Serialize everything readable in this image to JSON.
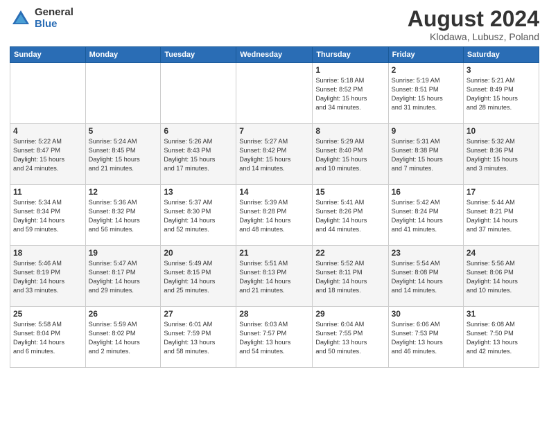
{
  "header": {
    "logo_general": "General",
    "logo_blue": "Blue",
    "title": "August 2024",
    "location": "Klodawa, Lubusz, Poland"
  },
  "weekdays": [
    "Sunday",
    "Monday",
    "Tuesday",
    "Wednesday",
    "Thursday",
    "Friday",
    "Saturday"
  ],
  "weeks": [
    [
      {
        "day": "",
        "info": ""
      },
      {
        "day": "",
        "info": ""
      },
      {
        "day": "",
        "info": ""
      },
      {
        "day": "",
        "info": ""
      },
      {
        "day": "1",
        "info": "Sunrise: 5:18 AM\nSunset: 8:52 PM\nDaylight: 15 hours\nand 34 minutes."
      },
      {
        "day": "2",
        "info": "Sunrise: 5:19 AM\nSunset: 8:51 PM\nDaylight: 15 hours\nand 31 minutes."
      },
      {
        "day": "3",
        "info": "Sunrise: 5:21 AM\nSunset: 8:49 PM\nDaylight: 15 hours\nand 28 minutes."
      }
    ],
    [
      {
        "day": "4",
        "info": "Sunrise: 5:22 AM\nSunset: 8:47 PM\nDaylight: 15 hours\nand 24 minutes."
      },
      {
        "day": "5",
        "info": "Sunrise: 5:24 AM\nSunset: 8:45 PM\nDaylight: 15 hours\nand 21 minutes."
      },
      {
        "day": "6",
        "info": "Sunrise: 5:26 AM\nSunset: 8:43 PM\nDaylight: 15 hours\nand 17 minutes."
      },
      {
        "day": "7",
        "info": "Sunrise: 5:27 AM\nSunset: 8:42 PM\nDaylight: 15 hours\nand 14 minutes."
      },
      {
        "day": "8",
        "info": "Sunrise: 5:29 AM\nSunset: 8:40 PM\nDaylight: 15 hours\nand 10 minutes."
      },
      {
        "day": "9",
        "info": "Sunrise: 5:31 AM\nSunset: 8:38 PM\nDaylight: 15 hours\nand 7 minutes."
      },
      {
        "day": "10",
        "info": "Sunrise: 5:32 AM\nSunset: 8:36 PM\nDaylight: 15 hours\nand 3 minutes."
      }
    ],
    [
      {
        "day": "11",
        "info": "Sunrise: 5:34 AM\nSunset: 8:34 PM\nDaylight: 14 hours\nand 59 minutes."
      },
      {
        "day": "12",
        "info": "Sunrise: 5:36 AM\nSunset: 8:32 PM\nDaylight: 14 hours\nand 56 minutes."
      },
      {
        "day": "13",
        "info": "Sunrise: 5:37 AM\nSunset: 8:30 PM\nDaylight: 14 hours\nand 52 minutes."
      },
      {
        "day": "14",
        "info": "Sunrise: 5:39 AM\nSunset: 8:28 PM\nDaylight: 14 hours\nand 48 minutes."
      },
      {
        "day": "15",
        "info": "Sunrise: 5:41 AM\nSunset: 8:26 PM\nDaylight: 14 hours\nand 44 minutes."
      },
      {
        "day": "16",
        "info": "Sunrise: 5:42 AM\nSunset: 8:24 PM\nDaylight: 14 hours\nand 41 minutes."
      },
      {
        "day": "17",
        "info": "Sunrise: 5:44 AM\nSunset: 8:21 PM\nDaylight: 14 hours\nand 37 minutes."
      }
    ],
    [
      {
        "day": "18",
        "info": "Sunrise: 5:46 AM\nSunset: 8:19 PM\nDaylight: 14 hours\nand 33 minutes."
      },
      {
        "day": "19",
        "info": "Sunrise: 5:47 AM\nSunset: 8:17 PM\nDaylight: 14 hours\nand 29 minutes."
      },
      {
        "day": "20",
        "info": "Sunrise: 5:49 AM\nSunset: 8:15 PM\nDaylight: 14 hours\nand 25 minutes."
      },
      {
        "day": "21",
        "info": "Sunrise: 5:51 AM\nSunset: 8:13 PM\nDaylight: 14 hours\nand 21 minutes."
      },
      {
        "day": "22",
        "info": "Sunrise: 5:52 AM\nSunset: 8:11 PM\nDaylight: 14 hours\nand 18 minutes."
      },
      {
        "day": "23",
        "info": "Sunrise: 5:54 AM\nSunset: 8:08 PM\nDaylight: 14 hours\nand 14 minutes."
      },
      {
        "day": "24",
        "info": "Sunrise: 5:56 AM\nSunset: 8:06 PM\nDaylight: 14 hours\nand 10 minutes."
      }
    ],
    [
      {
        "day": "25",
        "info": "Sunrise: 5:58 AM\nSunset: 8:04 PM\nDaylight: 14 hours\nand 6 minutes."
      },
      {
        "day": "26",
        "info": "Sunrise: 5:59 AM\nSunset: 8:02 PM\nDaylight: 14 hours\nand 2 minutes."
      },
      {
        "day": "27",
        "info": "Sunrise: 6:01 AM\nSunset: 7:59 PM\nDaylight: 13 hours\nand 58 minutes."
      },
      {
        "day": "28",
        "info": "Sunrise: 6:03 AM\nSunset: 7:57 PM\nDaylight: 13 hours\nand 54 minutes."
      },
      {
        "day": "29",
        "info": "Sunrise: 6:04 AM\nSunset: 7:55 PM\nDaylight: 13 hours\nand 50 minutes."
      },
      {
        "day": "30",
        "info": "Sunrise: 6:06 AM\nSunset: 7:53 PM\nDaylight: 13 hours\nand 46 minutes."
      },
      {
        "day": "31",
        "info": "Sunrise: 6:08 AM\nSunset: 7:50 PM\nDaylight: 13 hours\nand 42 minutes."
      }
    ]
  ]
}
